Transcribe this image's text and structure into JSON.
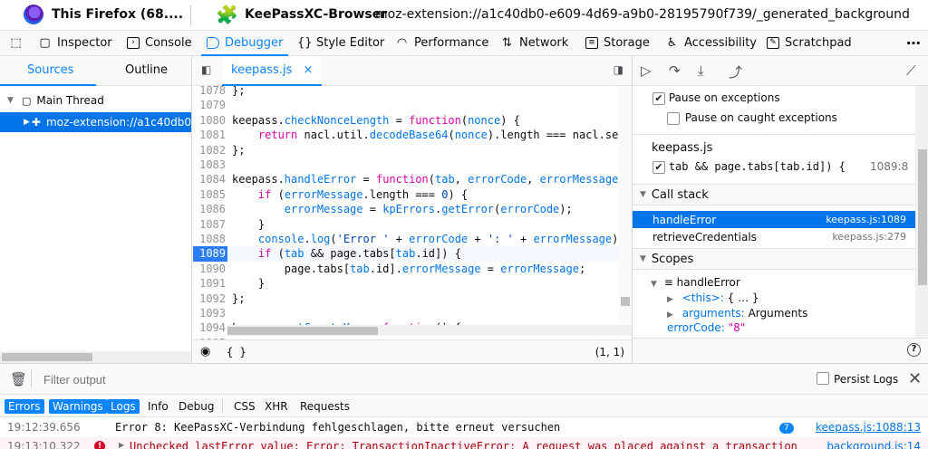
{
  "titlebar": {
    "left_title": "This Firefox (68....",
    "ext_title": "KeePassXC-Browser",
    "url": "moz-extension://a1c40db0-e609-4d69-a9b0-28195790f739/_generated_background_..."
  },
  "tools": {
    "inspector": "Inspector",
    "console": "Console",
    "debugger": "Debugger",
    "style_editor": "Style Editor",
    "performance": "Performance",
    "network": "Network",
    "storage": "Storage",
    "accessibility": "Accessibility",
    "scratchpad": "Scratchpad",
    "more": "⋯"
  },
  "sources": {
    "tab_sources": "Sources",
    "tab_outline": "Outline",
    "thread": "Main Thread",
    "ext_item": "moz-extension://a1c40db0-"
  },
  "editor": {
    "file_tab": "keepass.js",
    "close": "×",
    "footer_braces": "{ }",
    "cursor_pos": "(1, 1)",
    "lines": [
      {
        "n": "1078",
        "t": "};"
      },
      {
        "n": "1079",
        "t": ""
      },
      {
        "n": "1080",
        "t": "keepass.checkNonceLength = function(nonce) {"
      },
      {
        "n": "1081",
        "t": "    return nacl.util.decodeBase64(nonce).length === nacl.secr"
      },
      {
        "n": "1082",
        "t": "};"
      },
      {
        "n": "1083",
        "t": ""
      },
      {
        "n": "1084",
        "t": "keepass.handleError = function(tab, errorCode, errorMessage ="
      },
      {
        "n": "1085",
        "t": "    if (errorMessage.length === 0) {"
      },
      {
        "n": "1086",
        "t": "        errorMessage = kpErrors.getError(errorCode);"
      },
      {
        "n": "1087",
        "t": "    }"
      },
      {
        "n": "1088",
        "t": "    console.log('Error ' + errorCode + ': ' + errorMessage);"
      },
      {
        "n": "1089",
        "t": "    if (tab && page.tabs[tab.id]) {"
      },
      {
        "n": "1090",
        "t": "        page.tabs[tab.id].errorMessage = errorMessage;"
      },
      {
        "n": "1091",
        "t": "    }"
      },
      {
        "n": "1092",
        "t": "};"
      },
      {
        "n": "1093",
        "t": ""
      },
      {
        "n": "1094",
        "t": "keepass.getCryptoKey = function() {"
      },
      {
        "n": "1095",
        "t": ""
      }
    ]
  },
  "breakpoints": {
    "pause_exceptions": "Pause on exceptions",
    "pause_caught": "Pause on caught exceptions",
    "file": "keepass.js",
    "bp_text": "tab && page.tabs[tab.id]) {",
    "bp_loc": "1089:8"
  },
  "callstack": {
    "title": "Call stack",
    "frames": [
      {
        "name": "handleError",
        "loc": "keepass.js:1089"
      },
      {
        "name": "retrieveCredentials",
        "loc": "keepass.js:279"
      }
    ]
  },
  "scopes": {
    "title": "Scopes",
    "fn": "handleError",
    "this_label": "<this>:",
    "this_val": "{ … }",
    "args_label": "arguments:",
    "args_val": "Arguments",
    "errcode_label": "errorCode:",
    "errcode_val": "\"8\""
  },
  "console": {
    "filter_placeholder": "Filter output",
    "persist": "Persist Logs",
    "filters": [
      "Errors",
      "Warnings",
      "Logs",
      "Info",
      "Debug",
      "CSS",
      "XHR",
      "Requests"
    ],
    "messages": [
      {
        "time": "19:12:39.656",
        "text": "Error 8: KeePassXC-Verbindung fehlgeschlagen, bitte erneut versuchen",
        "count": "7",
        "src": "keepass.js:1088:13"
      },
      {
        "time": "19:13:10.322",
        "text": "Unchecked lastError value: Error: TransactionInactiveError: A request was placed against a transaction",
        "src": "background.js:14"
      }
    ]
  },
  "colors": {
    "accent": "#0a84ff",
    "selection": "#0074e8",
    "keyword": "#dd00a9"
  }
}
